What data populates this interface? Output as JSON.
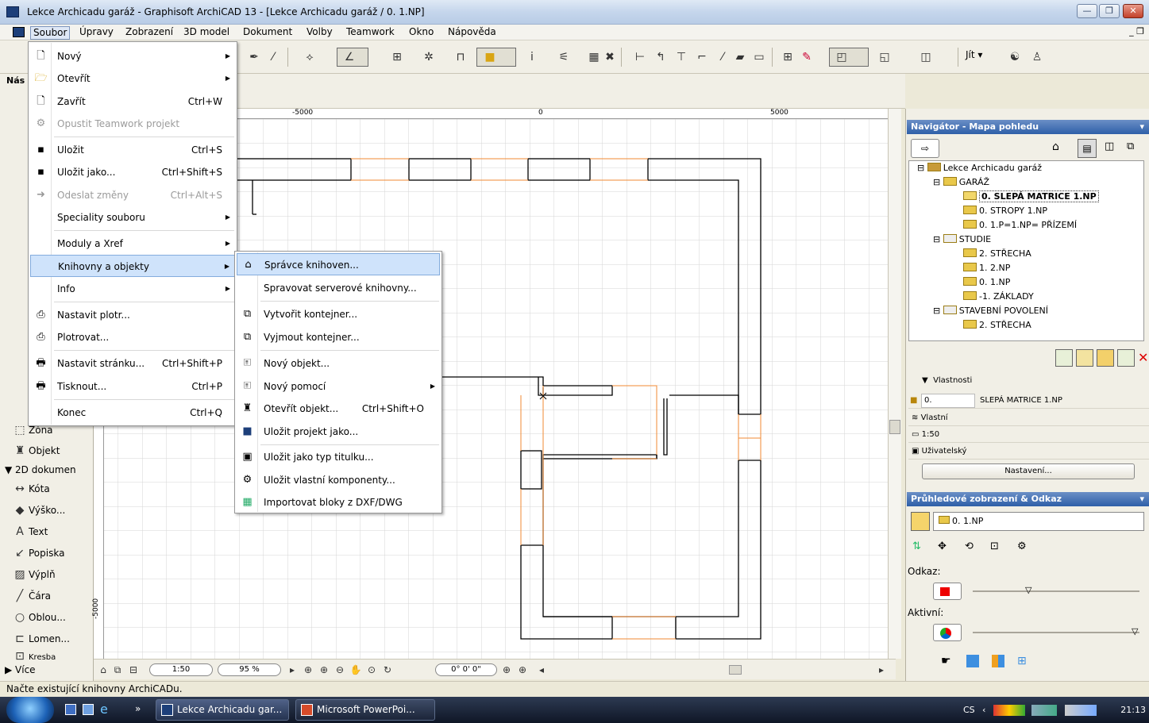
{
  "window": {
    "title": "Lekce Archicadu garáž - Graphisoft ArchiCAD 13 - [Lekce Archicadu garáž / 0. 1.NP]",
    "minimize": "—",
    "maximize": "❐",
    "close": "✕"
  },
  "menubar": {
    "items": [
      "Soubor",
      "Úpravy",
      "Zobrazení",
      "3D model",
      "Dokument",
      "Volby",
      "Teamwork",
      "Okno",
      "Nápověda"
    ],
    "mdi_controls": "_ ❐"
  },
  "toolbar": {
    "jit_label": "Jít ▾"
  },
  "toolbox": {
    "title": "Nás",
    "items": [
      {
        "label": "Zóna"
      },
      {
        "label": "Objekt"
      }
    ],
    "section_2d": "▼ 2D dokumen",
    "items_2d": [
      {
        "label": "Kóta"
      },
      {
        "label": "Výško..."
      },
      {
        "label": "Text"
      },
      {
        "label": "Popiska"
      },
      {
        "label": "Výplň"
      },
      {
        "label": "Čára"
      },
      {
        "label": "Oblou..."
      },
      {
        "label": "Lomen..."
      },
      {
        "label": "Kresba"
      }
    ],
    "more": "▶ Více"
  },
  "ruler": {
    "minus": "-5000",
    "zero": "0",
    "plus": "5000",
    "left": "-5000"
  },
  "canvas_bar": {
    "scale": "1:50",
    "zoom": "95 %",
    "angle": "0° 0' 0\""
  },
  "status": {
    "text": "Načte existující knihovny ArchiCADu."
  },
  "file_menu": {
    "items": [
      {
        "label": "Nový",
        "shortcut": "",
        "submenu": true,
        "disabled": false
      },
      {
        "label": "Otevřít",
        "shortcut": "",
        "submenu": true,
        "disabled": false
      },
      {
        "label": "Zavřít",
        "shortcut": "Ctrl+W",
        "submenu": false,
        "disabled": false
      },
      {
        "label": "Opustit Teamwork projekt",
        "shortcut": "",
        "submenu": false,
        "disabled": true
      },
      {
        "label": "Uložit",
        "shortcut": "Ctrl+S",
        "submenu": false,
        "disabled": false
      },
      {
        "label": "Uložit jako...",
        "shortcut": "Ctrl+Shift+S",
        "submenu": false,
        "disabled": false
      },
      {
        "label": "Odeslat změny",
        "shortcut": "Ctrl+Alt+S",
        "submenu": false,
        "disabled": true
      },
      {
        "label": "Speciality souboru",
        "shortcut": "",
        "submenu": true,
        "disabled": false
      },
      {
        "label": "Moduly a Xref",
        "shortcut": "",
        "submenu": true,
        "disabled": false
      },
      {
        "label": "Knihovny a objekty",
        "shortcut": "",
        "submenu": true,
        "disabled": false
      },
      {
        "label": "Info",
        "shortcut": "",
        "submenu": true,
        "disabled": false
      },
      {
        "label": "Nastavit plotr...",
        "shortcut": "",
        "submenu": false,
        "disabled": false
      },
      {
        "label": "Plotrovat...",
        "shortcut": "",
        "submenu": false,
        "disabled": false
      },
      {
        "label": "Nastavit stránku...",
        "shortcut": "Ctrl+Shift+P",
        "submenu": false,
        "disabled": false
      },
      {
        "label": "Tisknout...",
        "shortcut": "Ctrl+P",
        "submenu": false,
        "disabled": false
      },
      {
        "label": "Konec",
        "shortcut": "Ctrl+Q",
        "submenu": false,
        "disabled": false
      }
    ]
  },
  "library_submenu": {
    "items": [
      {
        "label": "Správce knihoven...",
        "shortcut": ""
      },
      {
        "label": "Spravovat serverové knihovny...",
        "shortcut": ""
      },
      {
        "label": "Vytvořit kontejner...",
        "shortcut": ""
      },
      {
        "label": "Vyjmout kontejner...",
        "shortcut": ""
      },
      {
        "label": "Nový objekt...",
        "shortcut": ""
      },
      {
        "label": "Nový pomocí",
        "shortcut": ""
      },
      {
        "label": "Otevřít objekt...",
        "shortcut": "Ctrl+Shift+O"
      },
      {
        "label": "Uložit projekt jako...",
        "shortcut": ""
      },
      {
        "label": "Uložit jako typ titulku...",
        "shortcut": ""
      },
      {
        "label": "Uložit vlastní komponenty...",
        "shortcut": ""
      },
      {
        "label": "Importovat bloky z DXF/DWG",
        "shortcut": ""
      }
    ]
  },
  "navigator": {
    "title": "Navigátor - Mapa pohledu",
    "tree": [
      {
        "label": "Lekce Archicadu garáž",
        "level": 0
      },
      {
        "label": "GARÁŽ",
        "level": 1
      },
      {
        "label": "0. SLEPÁ MATRICE 1.NP",
        "level": 2,
        "selected": true
      },
      {
        "label": "0. STROPY 1.NP",
        "level": 2
      },
      {
        "label": "0. 1.P=1.NP= PŘÍZEMÍ",
        "level": 2
      },
      {
        "label": "STUDIE",
        "level": 1
      },
      {
        "label": "2. STŘECHA",
        "level": 2
      },
      {
        "label": "1. 2.NP",
        "level": 2
      },
      {
        "label": "0. 1.NP",
        "level": 2
      },
      {
        "label": "-1. ZÁKLADY",
        "level": 2
      },
      {
        "label": "STAVEBNÍ POVOLENÍ",
        "level": 1
      },
      {
        "label": "2. STŘECHA",
        "level": 2
      }
    ],
    "props_title": "Vlastnosti",
    "prop_id": "0.",
    "prop_name": "SLEPÁ MATRICE 1.NP",
    "prop_layer": "Vlastní",
    "prop_scale": "1:50",
    "prop_user": "Uživatelský",
    "settings_button": "Nastavení..."
  },
  "overlay": {
    "title": "Průhledové zobrazení & Odkaz",
    "story": "0. 1.NP",
    "reference_label": "Odkaz:",
    "active_label": "Aktivní:"
  },
  "taskbar": {
    "buttons": [
      "Lekce Archicadu gar...",
      "Microsoft PowerPoi..."
    ],
    "lang": "CS",
    "time": "21:13"
  }
}
